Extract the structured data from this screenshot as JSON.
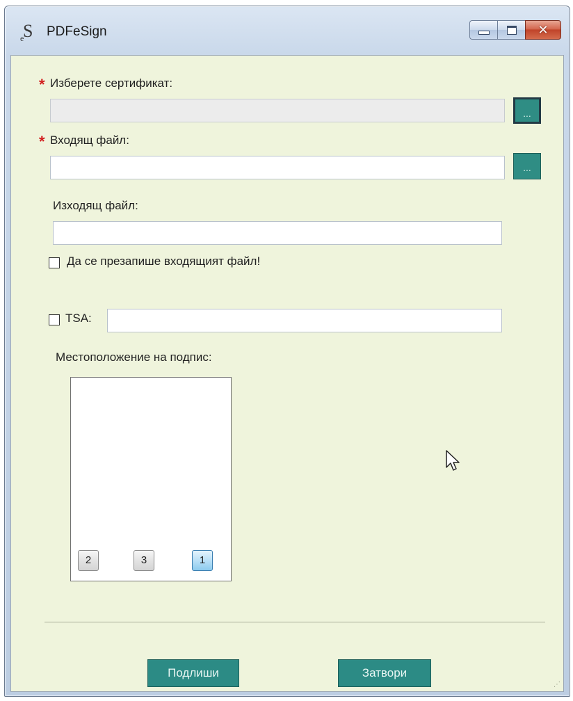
{
  "window": {
    "title": "PDFeSign",
    "icon": "eS-logo-icon",
    "close_glyph": "✕"
  },
  "form": {
    "certificate_label": "Изберете сертификат:",
    "certificate_value": "",
    "certificate_browse": "...",
    "input_file_label": "Входящ файл:",
    "input_file_value": "",
    "input_file_browse": "...",
    "output_file_label": "Изходящ файл:",
    "output_file_value": "",
    "overwrite_label": "Да се презапише входящият файл!",
    "overwrite_checked": false,
    "tsa_label": "TSA:",
    "tsa_checked": false,
    "tsa_value": "",
    "required_marker": "*"
  },
  "signature_position": {
    "label": "Местоположение на подпис:",
    "buttons": [
      {
        "label": "2",
        "selected": false
      },
      {
        "label": "3",
        "selected": false
      },
      {
        "label": "1",
        "selected": true
      }
    ]
  },
  "actions": {
    "sign_label": "Подлиши",
    "close_label": "Затвори"
  },
  "colors": {
    "client_bg": "#eff4dc",
    "accent_teal": "#2f8d84",
    "required_red": "#d21f1f"
  }
}
